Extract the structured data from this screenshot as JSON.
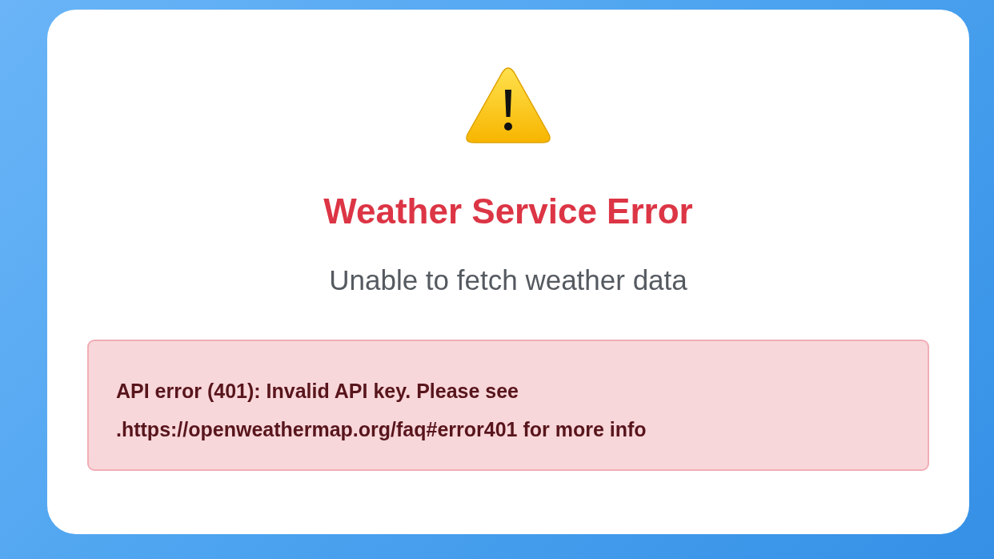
{
  "error_card": {
    "title": "Weather Service Error",
    "subtitle": "Unable to fetch weather data",
    "message": "API error (401): Invalid API key. Please see .https://openweathermap.org/faq#error401 for more info"
  }
}
